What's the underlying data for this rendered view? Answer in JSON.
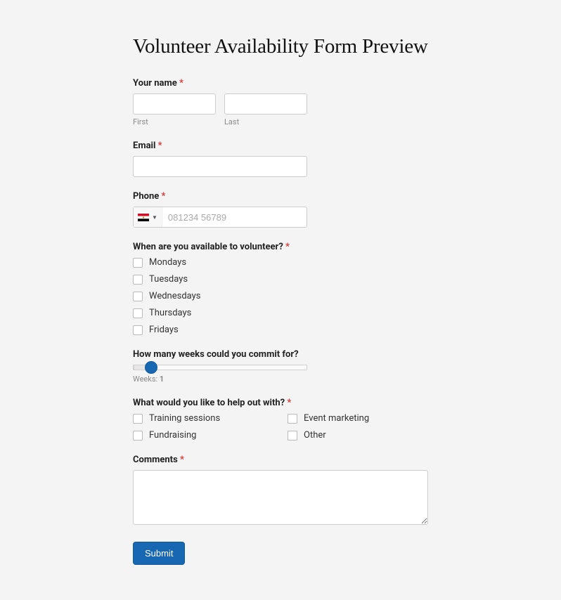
{
  "title": "Volunteer Availability Form Preview",
  "fields": {
    "name": {
      "label": "Your name",
      "required": "*",
      "first_sub": "First",
      "last_sub": "Last"
    },
    "email": {
      "label": "Email",
      "required": "*"
    },
    "phone": {
      "label": "Phone",
      "required": "*",
      "placeholder": "081234 56789"
    },
    "availability": {
      "label": "When are you available to volunteer?",
      "required": "*",
      "options": [
        "Mondays",
        "Tuesdays",
        "Wednesdays",
        "Thursdays",
        "Fridays"
      ]
    },
    "weeks": {
      "label": "How many weeks could you commit for?",
      "value_label": "Weeks:",
      "value": "1"
    },
    "help": {
      "label": "What would you like to help out with?",
      "required": "*",
      "options": [
        "Training sessions",
        "Event marketing",
        "Fundraising",
        "Other"
      ]
    },
    "comments": {
      "label": "Comments",
      "required": "*"
    }
  },
  "submit_label": "Submit"
}
